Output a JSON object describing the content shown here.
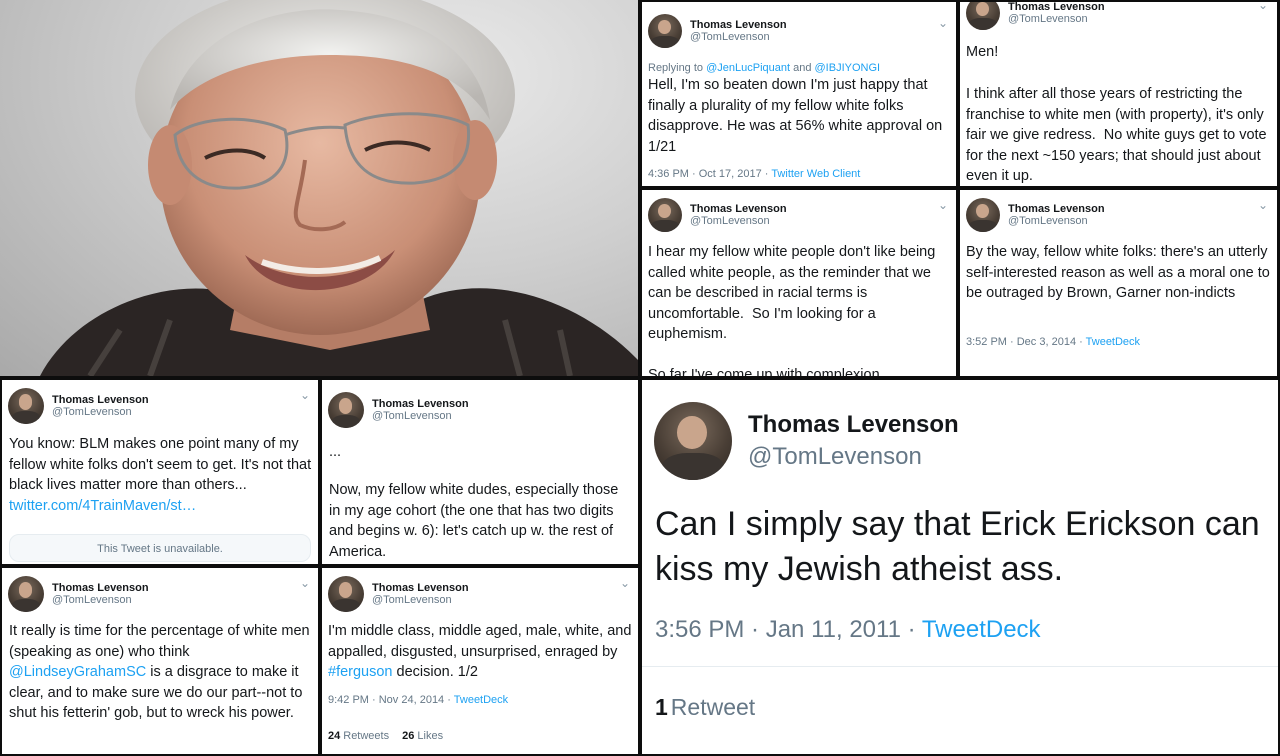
{
  "author": {
    "name": "Thomas Levenson",
    "handle": "@TomLevenson"
  },
  "colors": {
    "link": "#1da1f2",
    "muted": "#657786",
    "text": "#14171a",
    "gutter": "#0d0d0d"
  },
  "icons": {
    "chevron": "chevron-down-icon"
  },
  "tweets": {
    "t1": {
      "reply_prefix": "Replying to ",
      "reply_user1": "@JenLucPiquant",
      "reply_and": " and ",
      "reply_user2": "@IBJIYONGI",
      "text": "Hell, I'm so beaten down I'm just happy that finally a plurality of my fellow white folks disapprove. He was at 56% white approval on 1/21",
      "time": "4:36 PM · Oct 17, 2017 · ",
      "source": "Twitter Web Client"
    },
    "t2": {
      "text_line1": "Men!",
      "text_rest": "I think after all those years of restricting the franchise to white men (with property), it's only fair we give redress.  No white guys get to vote for the next ~150 years; that should just about even it up."
    },
    "t3": {
      "text": "I hear my fellow white people don't like being called white people, as the reminder that we can be described in racial terms is uncomfortable.  So I'm looking for a euphemism.",
      "text_cut": "So far I've come up with complexion"
    },
    "t4": {
      "text": "By the way, fellow white folks: there's an utterly self-interested reason as well as a moral one to be outraged by Brown, Garner non-indicts",
      "time": "3:52 PM · Dec 3, 2014 · ",
      "source": "TweetDeck"
    },
    "t5": {
      "text": "You know: BLM makes one point many of my fellow white folks don't seem to get. It's not that black lives matter more than others... ",
      "link": "twitter.com/4TrainMaven/st…",
      "unavailable": "This Tweet is unavailable."
    },
    "t6": {
      "ellipsis": "...",
      "text": "Now, my fellow white dudes, especially those in my age cohort (the one that has two digits and begins w. 6): let's catch up w. the rest of America."
    },
    "t7": {
      "text_pre": "It really is time for the percentage of white men (speaking as one) who think ",
      "mention": "@LindseyGrahamSC",
      "text_post": " is a disgrace to make it clear, and to make sure we do our part--not to shut his fetterin' gob, but to wreck his power."
    },
    "t8": {
      "text_pre": "I'm middle class, middle aged, male, white, and appalled, disgusted, unsurprised, enraged by ",
      "hashtag": "#ferguson",
      "text_post": " decision. 1/2",
      "time": "9:42 PM · Nov 24, 2014 · ",
      "source": "TweetDeck",
      "retweets_count": "24",
      "retweets_label": "Retweets",
      "likes_count": "26",
      "likes_label": "Likes"
    },
    "t9": {
      "text": "Can I simply say that Erick Erickson can kiss my Jewish atheist ass.",
      "time": "3:56 PM · Jan 11, 2011 · ",
      "source": "TweetDeck",
      "retweet_count": "1",
      "retweet_label": "Retweet"
    }
  }
}
